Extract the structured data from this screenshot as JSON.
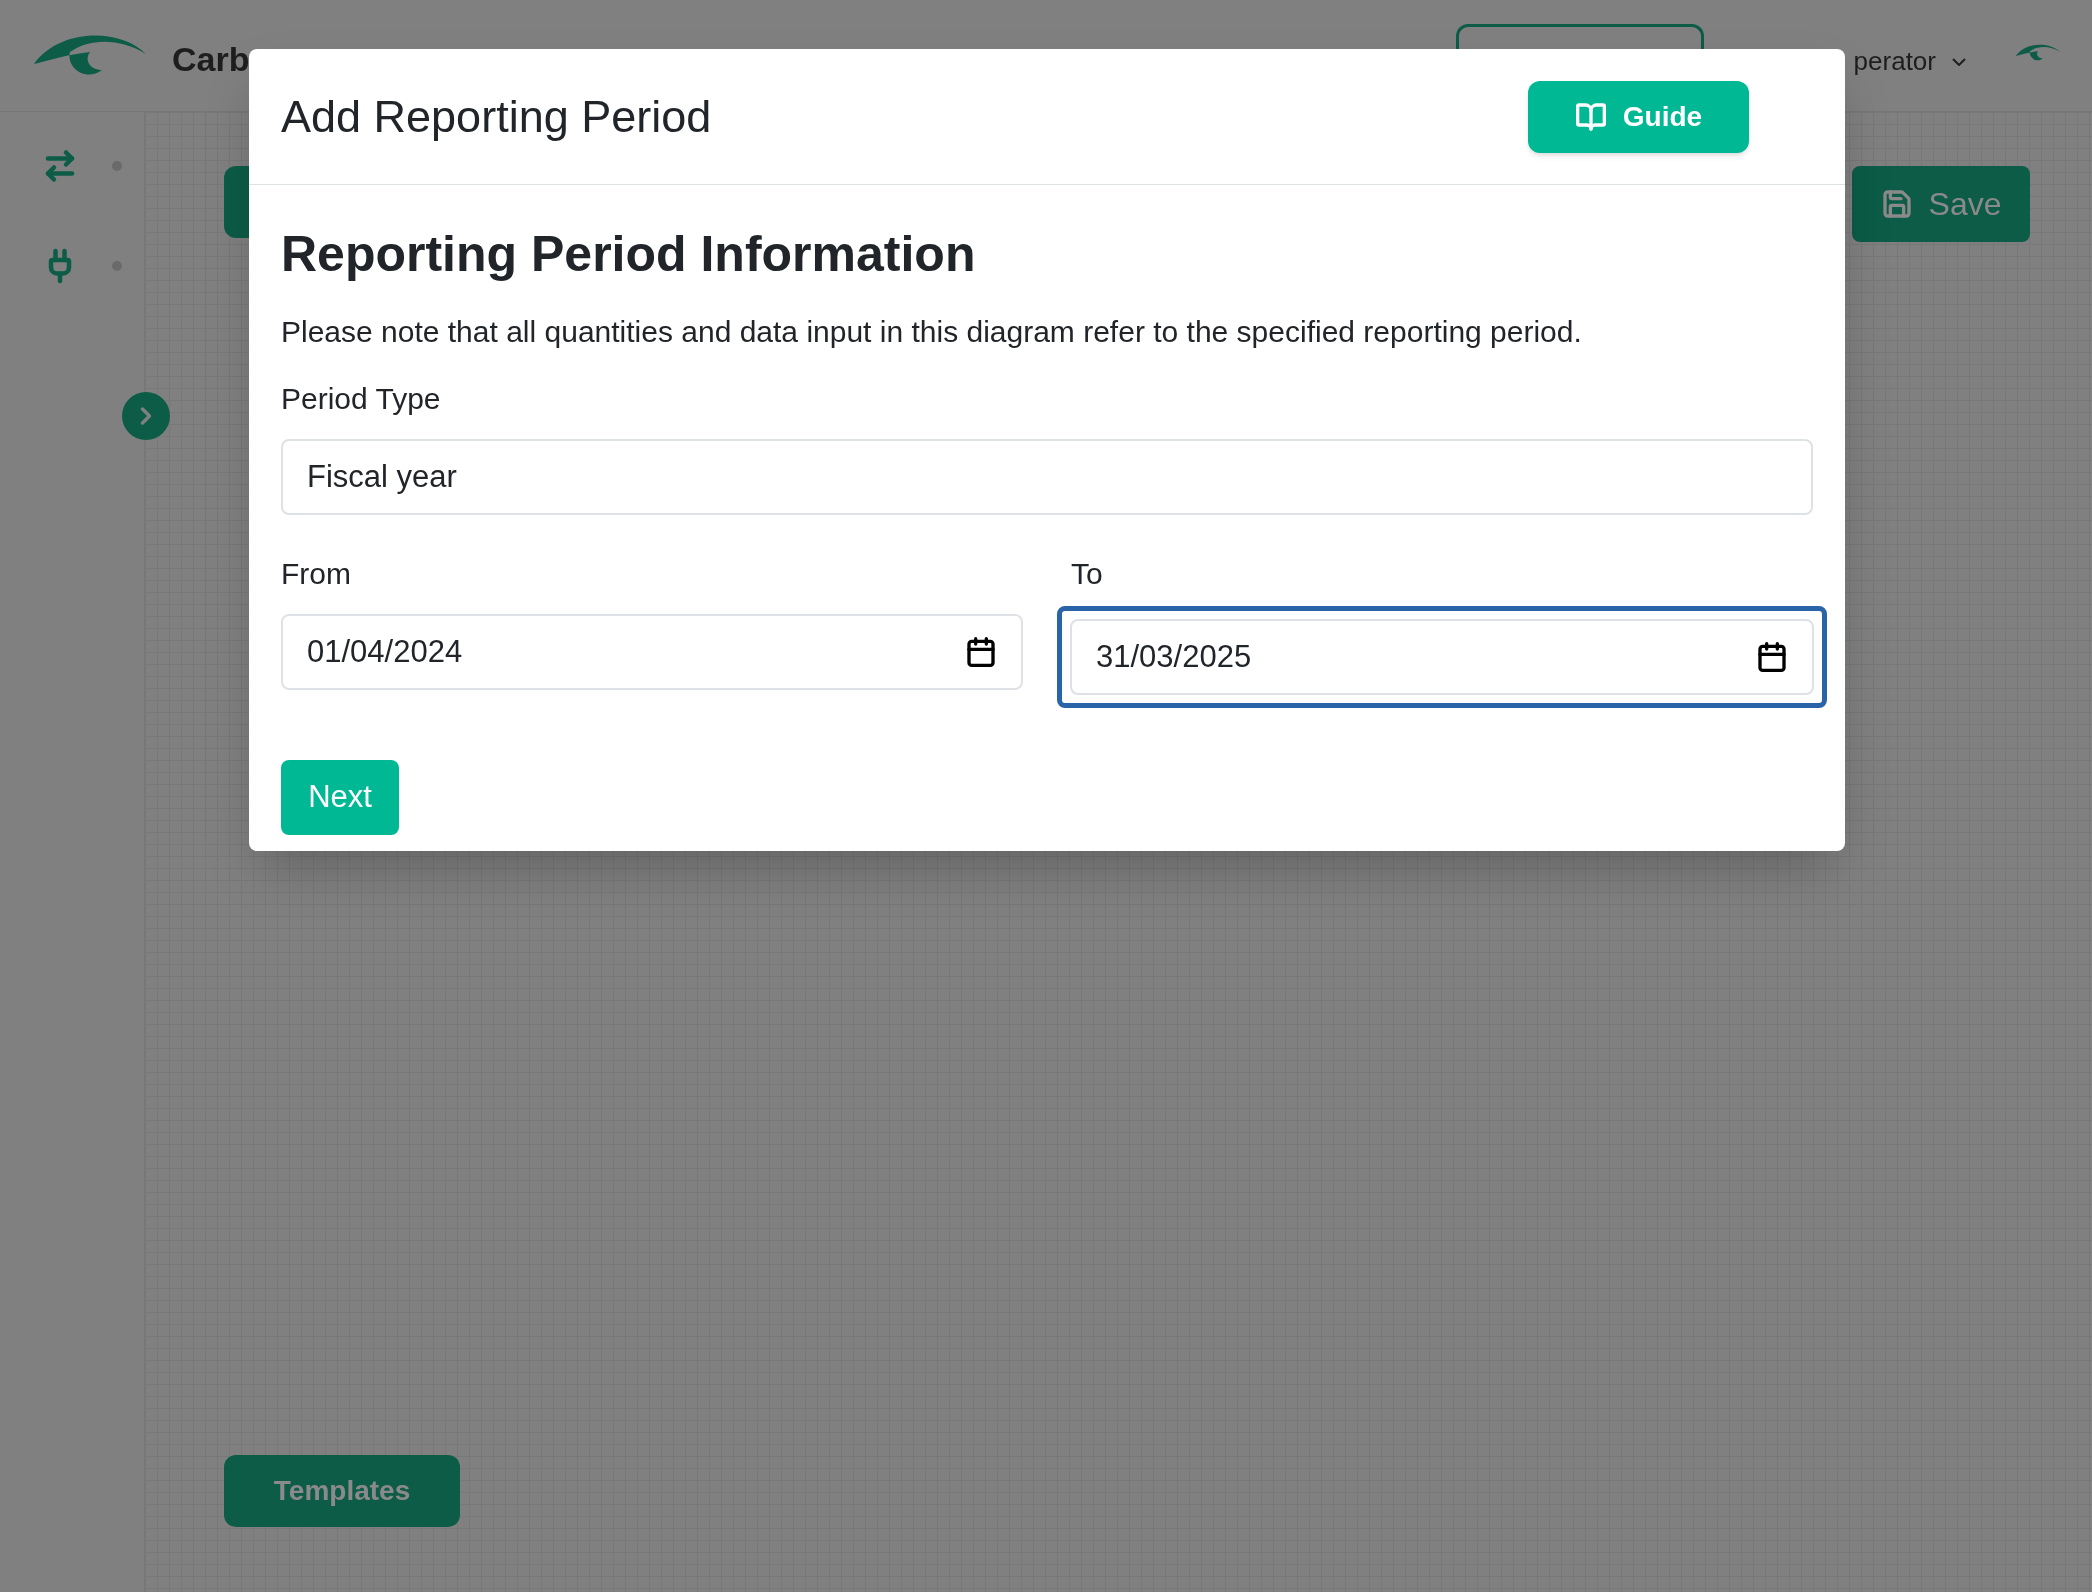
{
  "app": {
    "brand": "Carb",
    "user": "perator"
  },
  "toolbar": {
    "save": "Save",
    "templates": "Templates"
  },
  "modal": {
    "title": "Add Reporting Period",
    "guide": "Guide",
    "heading": "Reporting Period Information",
    "note": "Please note that all quantities and data input in this diagram refer to the specified reporting period.",
    "period_type": {
      "label": "Period Type",
      "value": "Fiscal year"
    },
    "dates": [
      {
        "label": "From",
        "value": "01/04/2024",
        "focused": false
      },
      {
        "label": "To",
        "value": "31/03/2025",
        "focused": true
      }
    ],
    "next": "Next"
  }
}
